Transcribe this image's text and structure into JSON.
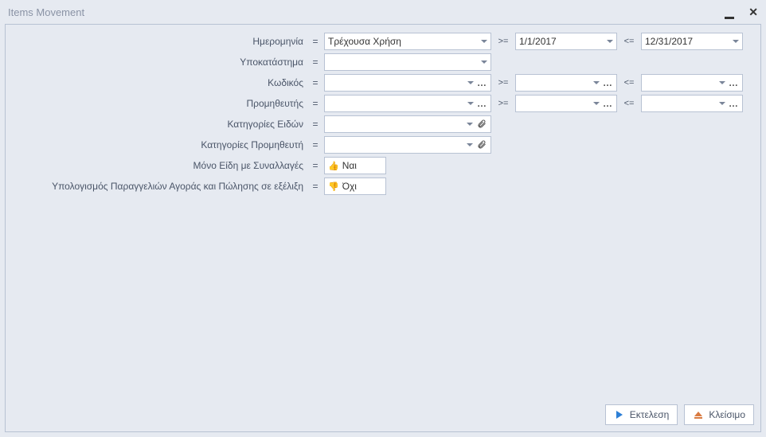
{
  "window": {
    "title": "Items Movement"
  },
  "form": {
    "date": {
      "label": "Ημερομηνία",
      "value": "Τρέχουσα Χρήση",
      "from": "1/1/2017",
      "to": "12/31/2017"
    },
    "branch": {
      "label": "Υποκατάστημα",
      "value": ""
    },
    "code": {
      "label": "Κωδικός",
      "value": "",
      "from": "",
      "to": ""
    },
    "supplier": {
      "label": "Προμηθευτής",
      "value": "",
      "from": "",
      "to": ""
    },
    "itemCategories": {
      "label": "Κατηγορίες Ειδών",
      "value": ""
    },
    "supplierCategories": {
      "label": "Κατηγορίες Προμηθευτή",
      "value": ""
    },
    "onlyWithTx": {
      "label": "Μόνο Είδη με Συναλλαγές",
      "value": "Ναι"
    },
    "calcOrders": {
      "label": "Υπολογισμός Παραγγελιών Αγοράς και Πώλησης σε εξέλιξη",
      "value": "Όχι"
    }
  },
  "ops": {
    "eq": "=",
    "gte": ">=",
    "lte": "<="
  },
  "buttons": {
    "run": "Εκτελεση",
    "close": "Κλείσιμο"
  }
}
